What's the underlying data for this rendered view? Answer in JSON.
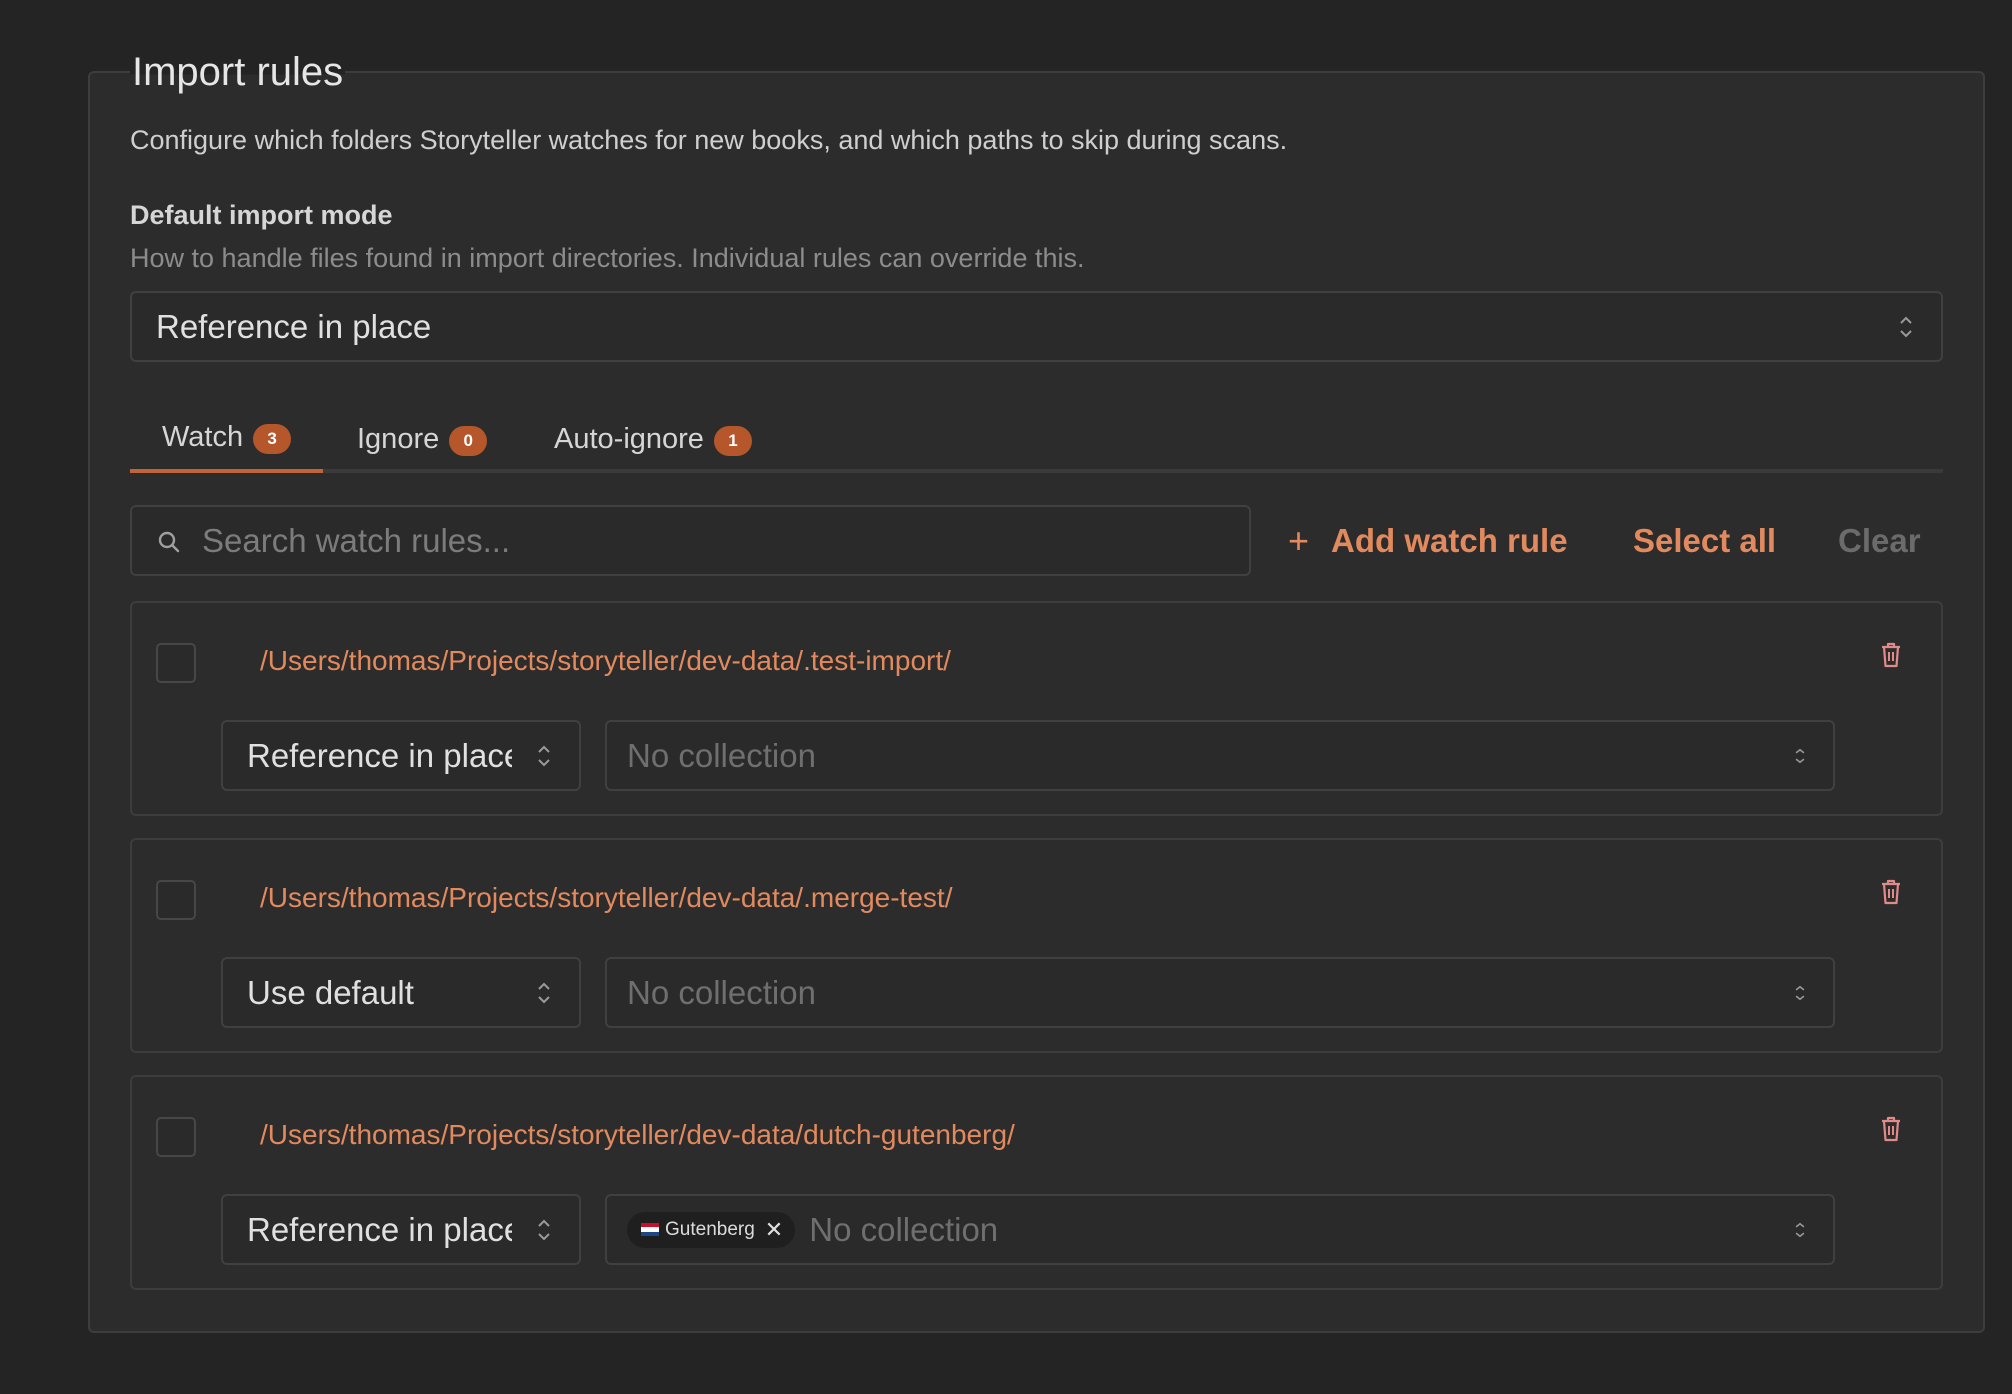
{
  "section": {
    "title": "Import rules",
    "description": "Configure which folders Storyteller watches for new books, and which paths to skip during scans."
  },
  "default_mode": {
    "label": "Default import mode",
    "hint": "How to handle files found in import directories. Individual rules can override this.",
    "value": "Reference in place"
  },
  "tabs": [
    {
      "label": "Watch",
      "count": "3",
      "active": true
    },
    {
      "label": "Ignore",
      "count": "0",
      "active": false
    },
    {
      "label": "Auto-ignore",
      "count": "1",
      "active": false
    }
  ],
  "toolbar": {
    "search_placeholder": "Search watch rules...",
    "add_label": "Add watch rule",
    "select_all_label": "Select all",
    "clear_label": "Clear"
  },
  "rules": [
    {
      "path": "/Users/thomas/Projects/storyteller/dev-data/.test-import/",
      "mode": "Reference in place",
      "collection_placeholder": "No collection",
      "collections": []
    },
    {
      "path": "/Users/thomas/Projects/storyteller/dev-data/.merge-test/",
      "mode": "Use default",
      "collection_placeholder": "No collection",
      "collections": []
    },
    {
      "path": "/Users/thomas/Projects/storyteller/dev-data/dutch-gutenberg/",
      "mode": "Reference in place",
      "collection_placeholder": "No collection",
      "collections": [
        {
          "name": "Gutenberg",
          "icon": "netherlands-flag-icon"
        }
      ]
    }
  ],
  "colors": {
    "accent": "#e28a5e",
    "badge": "#b6562b",
    "background": "#242424",
    "panel": "#2c2c2c"
  }
}
